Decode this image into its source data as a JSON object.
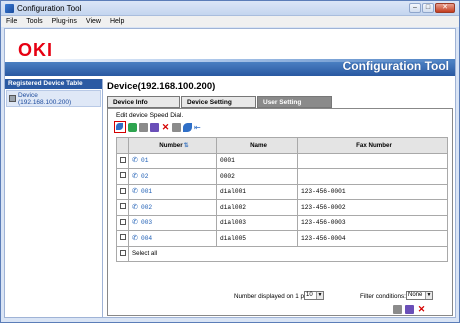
{
  "window": {
    "title": "Configuration Tool"
  },
  "menu": [
    "File",
    "Tools",
    "Plug-ins",
    "View",
    "Help"
  ],
  "brand": {
    "logo": "OKI",
    "app_title": "Configuration Tool",
    "logo_color": "#e60012",
    "band_color": "#2958a1"
  },
  "sidebar": {
    "heading": "Registered Device Table",
    "device_name": "Device",
    "device_ip": "(192.168.100.200)"
  },
  "device_title": "Device(192.168.100.200)",
  "tabs": [
    "Device Info",
    "Device Setting",
    "User Setting"
  ],
  "section_label": "Edit device Speed Dial.",
  "toolbar_icons": [
    "edit-speed-dial-icon",
    "add-icon",
    "import-icon",
    "export-icon",
    "delete-icon",
    "copy-icon",
    "print-icon",
    "back-icon"
  ],
  "table": {
    "headers": [
      "Number",
      "Name",
      "Fax Number"
    ],
    "rows": [
      {
        "number": "01",
        "name": "0001",
        "fax": ""
      },
      {
        "number": "02",
        "name": "0002",
        "fax": ""
      },
      {
        "number": "001",
        "name": "dial001",
        "fax": "123-456-0001"
      },
      {
        "number": "002",
        "name": "dial002",
        "fax": "123-456-0002"
      },
      {
        "number": "003",
        "name": "dial003",
        "fax": "123-456-0003"
      },
      {
        "number": "004",
        "name": "dial005",
        "fax": "123-456-0004"
      }
    ],
    "select_all": "Select all"
  },
  "footer": {
    "per_page_label": "Number displayed on 1 page:",
    "per_page_value": "10",
    "filter_label": "Filter conditions:",
    "filter_value": "None"
  }
}
